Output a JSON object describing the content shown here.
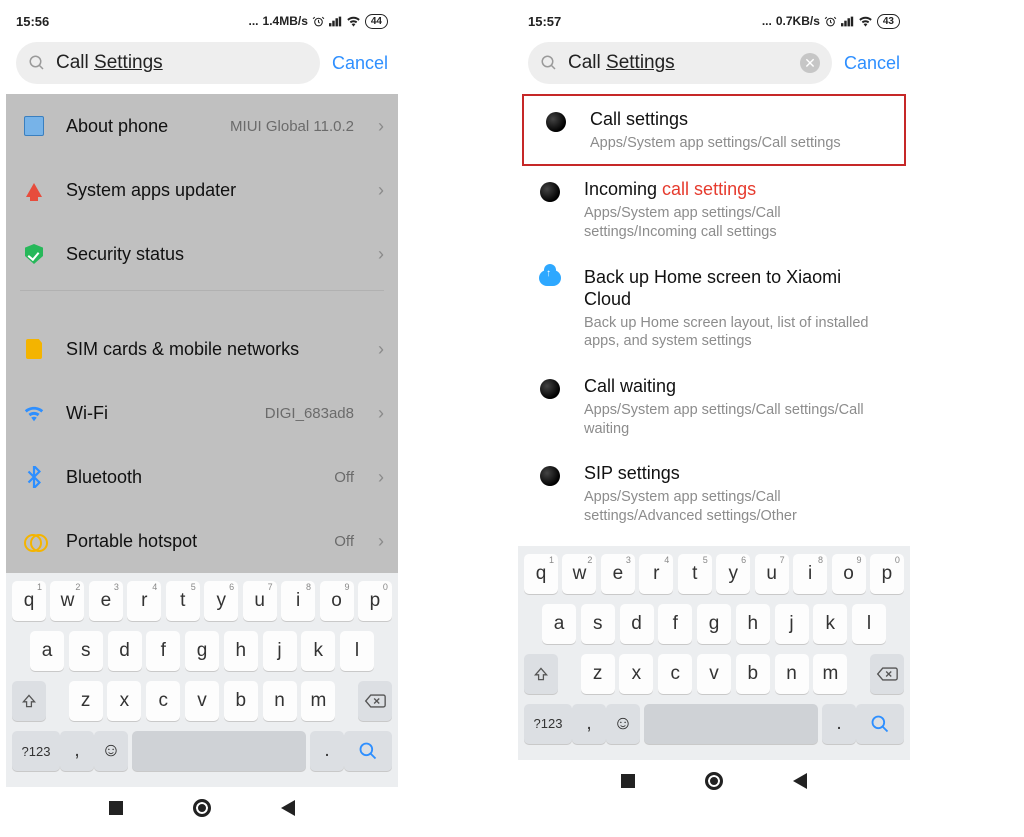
{
  "left": {
    "status": {
      "time": "15:56",
      "net": "1.4MB/s",
      "battery": "44"
    },
    "search": {
      "prefix": "Call ",
      "query": "Settings",
      "cancel": "Cancel"
    },
    "rows": {
      "about": {
        "label": "About phone",
        "value": "MIUI Global 11.0.2"
      },
      "updater": {
        "label": "System apps updater",
        "value": ""
      },
      "security": {
        "label": "Security status",
        "value": ""
      },
      "sim": {
        "label": "SIM cards & mobile networks",
        "value": ""
      },
      "wifi": {
        "label": "Wi-Fi",
        "value": "DIGI_683ad8"
      },
      "bt": {
        "label": "Bluetooth",
        "value": "Off"
      },
      "hotspot": {
        "label": "Portable hotspot",
        "value": "Off"
      }
    }
  },
  "right": {
    "status": {
      "time": "15:57",
      "net": "0.7KB/s",
      "battery": "43"
    },
    "search": {
      "prefix": "Call ",
      "query": "Settings",
      "cancel": "Cancel"
    },
    "results": {
      "r1": {
        "title_html": "Call settings",
        "path": "Apps/System app settings/Call settings"
      },
      "r2": {
        "t_a": "Incoming ",
        "t_b": "call settings",
        "path": "Apps/System app settings/Call settings/Incoming call settings"
      },
      "r3": {
        "title": "Back up Home screen to Xiaomi Cloud",
        "path": "Back up Home screen layout, list of installed apps, and system settings"
      },
      "r4": {
        "title": "Call waiting",
        "path": "Apps/System app settings/Call settings/Call waiting"
      },
      "r5": {
        "title": "SIP settings",
        "path": "Apps/System app settings/Call settings/Advanced settings/Other"
      }
    }
  },
  "keyboard": {
    "r1": [
      {
        "k": "q",
        "s": "1"
      },
      {
        "k": "w",
        "s": "2"
      },
      {
        "k": "e",
        "s": "3"
      },
      {
        "k": "r",
        "s": "4"
      },
      {
        "k": "t",
        "s": "5"
      },
      {
        "k": "y",
        "s": "6"
      },
      {
        "k": "u",
        "s": "7"
      },
      {
        "k": "i",
        "s": "8"
      },
      {
        "k": "o",
        "s": "9"
      },
      {
        "k": "p",
        "s": "0"
      }
    ],
    "r2": [
      "a",
      "s",
      "d",
      "f",
      "g",
      "h",
      "j",
      "k",
      "l"
    ],
    "r3": [
      "z",
      "x",
      "c",
      "v",
      "b",
      "n",
      "m"
    ],
    "sym": "?123"
  }
}
